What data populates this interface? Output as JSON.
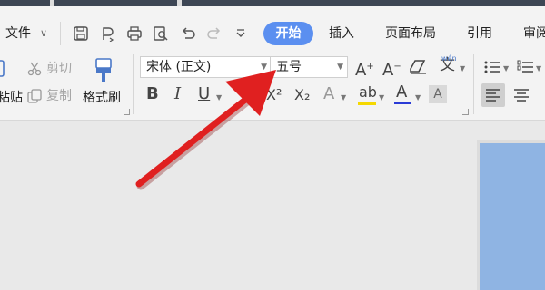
{
  "menu": {
    "file_label": "文件",
    "tabs": [
      {
        "label": "开始",
        "active": true
      },
      {
        "label": "插入"
      },
      {
        "label": "页面布局"
      },
      {
        "label": "引用"
      },
      {
        "label": "审阅"
      }
    ]
  },
  "ribbon": {
    "clipboard": {
      "paste_label": "粘贴",
      "cut_label": "剪切",
      "copy_label": "复制",
      "format_painter_label": "格式刷"
    },
    "font": {
      "font_name": "宋体 (正文)",
      "font_size": "五号",
      "superscript": "X²",
      "subscript": "X₂"
    }
  },
  "colors": {
    "accent": "#5b8ff0",
    "annotation_arrow": "#e02020",
    "highlight_yellow": "#f5d800",
    "font_color_blue": "#2a3bd6",
    "page_blue": "#8fb4e3"
  }
}
